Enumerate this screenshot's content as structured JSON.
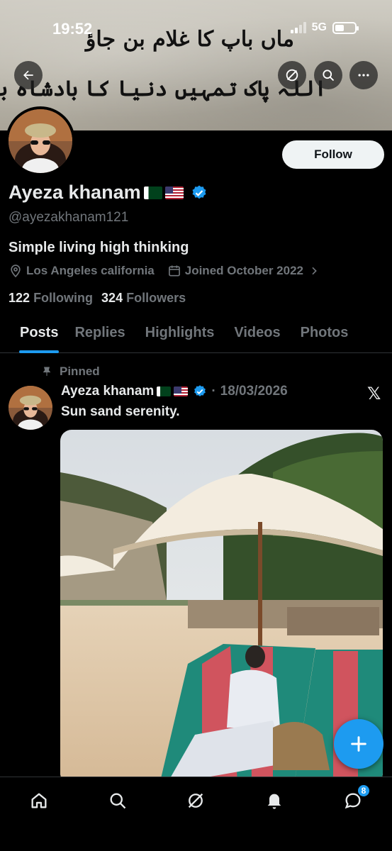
{
  "status_bar": {
    "time": "19:52",
    "network": "5G"
  },
  "banner": {
    "line1": "ماں باپ کا غلام بن جاؤ",
    "line2": "اللہ پاک تمہیں دنیا کا بادشاہ بنا دیگا ۔"
  },
  "header_icons": [
    "back-arrow-icon",
    "grok-icon",
    "search-icon",
    "more-icon"
  ],
  "profile": {
    "follow_label": "Follow",
    "name": "Ayeza khanam",
    "flags": [
      "pakistan-flag",
      "us-flag"
    ],
    "handle": "@ayezakhanam121",
    "bio": "Simple living high thinking",
    "location": "Los Angeles california",
    "joined": "Joined October 2022",
    "following_count": "122",
    "following_label": "Following",
    "followers_count": "324",
    "followers_label": "Followers"
  },
  "tabs": [
    {
      "label": "Posts",
      "active": true
    },
    {
      "label": "Replies",
      "active": false
    },
    {
      "label": "Highlights",
      "active": false
    },
    {
      "label": "Videos",
      "active": false
    },
    {
      "label": "Photos",
      "active": false
    }
  ],
  "post": {
    "pinned_label": "Pinned",
    "author": "Ayeza khanam",
    "separator": "·",
    "date": "18/03/2026",
    "source_icon": "𝕏",
    "text": "Sun sand serenity."
  },
  "bottom_nav": {
    "items": [
      "home-icon",
      "search-icon",
      "grok-icon",
      "notifications-icon",
      "messages-icon"
    ],
    "messages_badge": "8"
  },
  "colors": {
    "accent": "#1d9bf0",
    "background": "#000000",
    "secondary_text": "#71767b"
  }
}
